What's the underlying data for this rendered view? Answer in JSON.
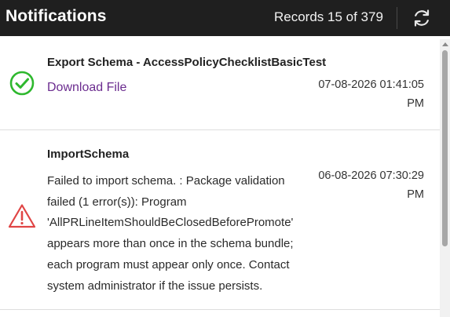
{
  "header": {
    "title": "Notifications",
    "records_text": "Records 15 of 379",
    "refresh_icon": "refresh-icon"
  },
  "notifications": [
    {
      "status": "success",
      "status_icon": "check-circle-icon",
      "title": "Export Schema - AccessPolicyChecklistBasicTest",
      "link_label": "Download File",
      "timestamp": "07-08-2026 01:41:05 PM"
    },
    {
      "status": "error",
      "status_icon": "warning-triangle-icon",
      "title": "ImportSchema",
      "message": "Failed to import schema. : Package validation failed (1 error(s)): Program 'AllPRLineItemShouldBeClosedBeforePromote' appears more than once in the schema bundle; each program must appear only once. Contact system administrator if the issue persists.",
      "timestamp": "06-08-2026 07:30:29 PM"
    }
  ],
  "colors": {
    "header_bg": "#1f1f1f",
    "success": "#2eb82e",
    "error": "#e04545",
    "link": "#6b2c8f"
  }
}
